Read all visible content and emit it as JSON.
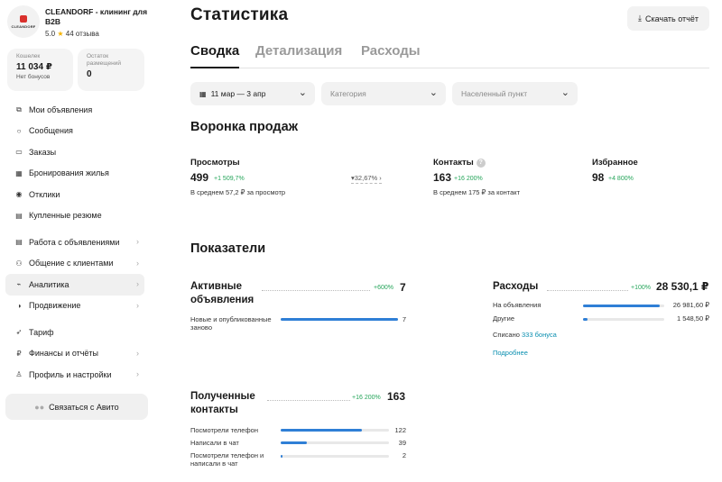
{
  "shop": {
    "logo_text": "CLEANDORF",
    "name": "CLEANDORF - клининг для B2B",
    "rating": "5.0",
    "reviews": "44 отзыва"
  },
  "wallet": {
    "label": "Кошелек",
    "value": "11 034 ₽",
    "sub": "Нет бонусов"
  },
  "placements": {
    "label": "Остаток размещений",
    "value": "0"
  },
  "nav": {
    "my_ads": "Мои объявления",
    "messages": "Сообщения",
    "orders": "Заказы",
    "bookings": "Бронирования жилья",
    "responses": "Отклики",
    "resumes": "Купленные резюме",
    "work_with_ads": "Работа с объявлениями",
    "clients": "Общение с клиентами",
    "analytics": "Аналитика",
    "promotion": "Продвижение",
    "tariff": "Тариф",
    "finance": "Финансы и отчёты",
    "profile": "Профиль и настройки"
  },
  "contact_avito": "Связаться с Авито",
  "page": {
    "title": "Статистика",
    "download": "Скачать отчёт"
  },
  "tabs": [
    "Сводка",
    "Детализация",
    "Расходы"
  ],
  "filters": {
    "date": "11 мар — 3 апр",
    "category_placeholder": "Категория",
    "city_placeholder": "Населенный пункт"
  },
  "funnel": {
    "title": "Воронка продаж",
    "views": {
      "label": "Просмотры",
      "value": "499",
      "delta": "+1 509,7%",
      "sub": "В среднем 57,2 ₽ за просмотр",
      "conversion": "32,67%"
    },
    "contacts": {
      "label": "Контакты",
      "value": "163",
      "delta": "+16 200%",
      "sub": "В среднем 175 ₽ за контакт"
    },
    "favorites": {
      "label": "Избранное",
      "value": "98",
      "delta": "+4 800%"
    }
  },
  "indicators": {
    "title": "Показатели",
    "active_ads": {
      "title": "Активные объявления",
      "delta": "+600%",
      "total": "7",
      "rows": [
        {
          "label": "Новые и опубликованные заново",
          "value": "7",
          "fill": 1.0
        }
      ]
    },
    "expenses": {
      "title": "Расходы",
      "delta": "+100%",
      "total": "28 530,1 ₽",
      "rows": [
        {
          "label": "На объявления",
          "value": "26 981,60 ₽",
          "fill": 0.945
        },
        {
          "label": "Другие",
          "value": "1 548,50 ₽",
          "fill": 0.054
        }
      ],
      "written_off_prefix": "Списано",
      "written_off_value": "333 бонуса",
      "more_link": "Подробнее"
    },
    "received_contacts": {
      "title": "Полученные контакты",
      "delta": "+16 200%",
      "total": "163",
      "rows": [
        {
          "label": "Посмотрели телефон",
          "value": "122",
          "fill": 0.75
        },
        {
          "label": "Написали в чат",
          "value": "39",
          "fill": 0.24
        },
        {
          "label": "Посмотрели телефон и написали в чат",
          "value": "2",
          "fill": 0.012
        }
      ]
    }
  },
  "colors": {
    "accent_blue": "#2f7fd6",
    "positive_green": "#25a55a",
    "link": "#0a8fb0"
  }
}
